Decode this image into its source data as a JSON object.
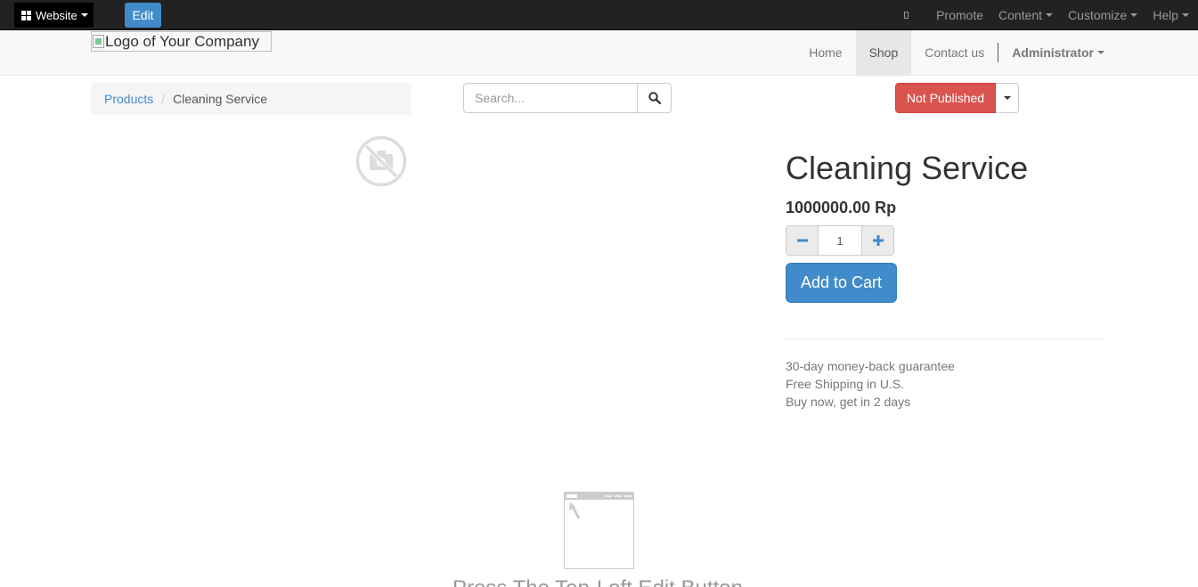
{
  "adminbar": {
    "website_label": "Website",
    "edit_label": "Edit",
    "right_items": [
      "Promote",
      "Content",
      "Customize",
      "Help"
    ]
  },
  "navbar": {
    "logo_alt": "Logo of Your Company",
    "links": [
      "Home",
      "Shop",
      "Contact us"
    ],
    "active_link": "Shop",
    "user_menu": "Administrator"
  },
  "breadcrumb": {
    "parent": "Products",
    "current": "Cleaning Service"
  },
  "search": {
    "placeholder": "Search..."
  },
  "publish": {
    "status_label": "Not Published",
    "status_color": "#d9534f"
  },
  "product": {
    "name": "Cleaning Service",
    "price": "1000000.00 Rp",
    "quantity": "1",
    "add_to_cart_label": "Add to Cart",
    "features": [
      "30-day money-back guarantee",
      "Free Shipping in U.S.",
      "Buy now, get in 2 days"
    ]
  },
  "hint": {
    "text": "Press The Top-Left Edit Button"
  },
  "colors": {
    "primary": "#428bca",
    "danger": "#d9534f",
    "adminbar": "#222222"
  }
}
